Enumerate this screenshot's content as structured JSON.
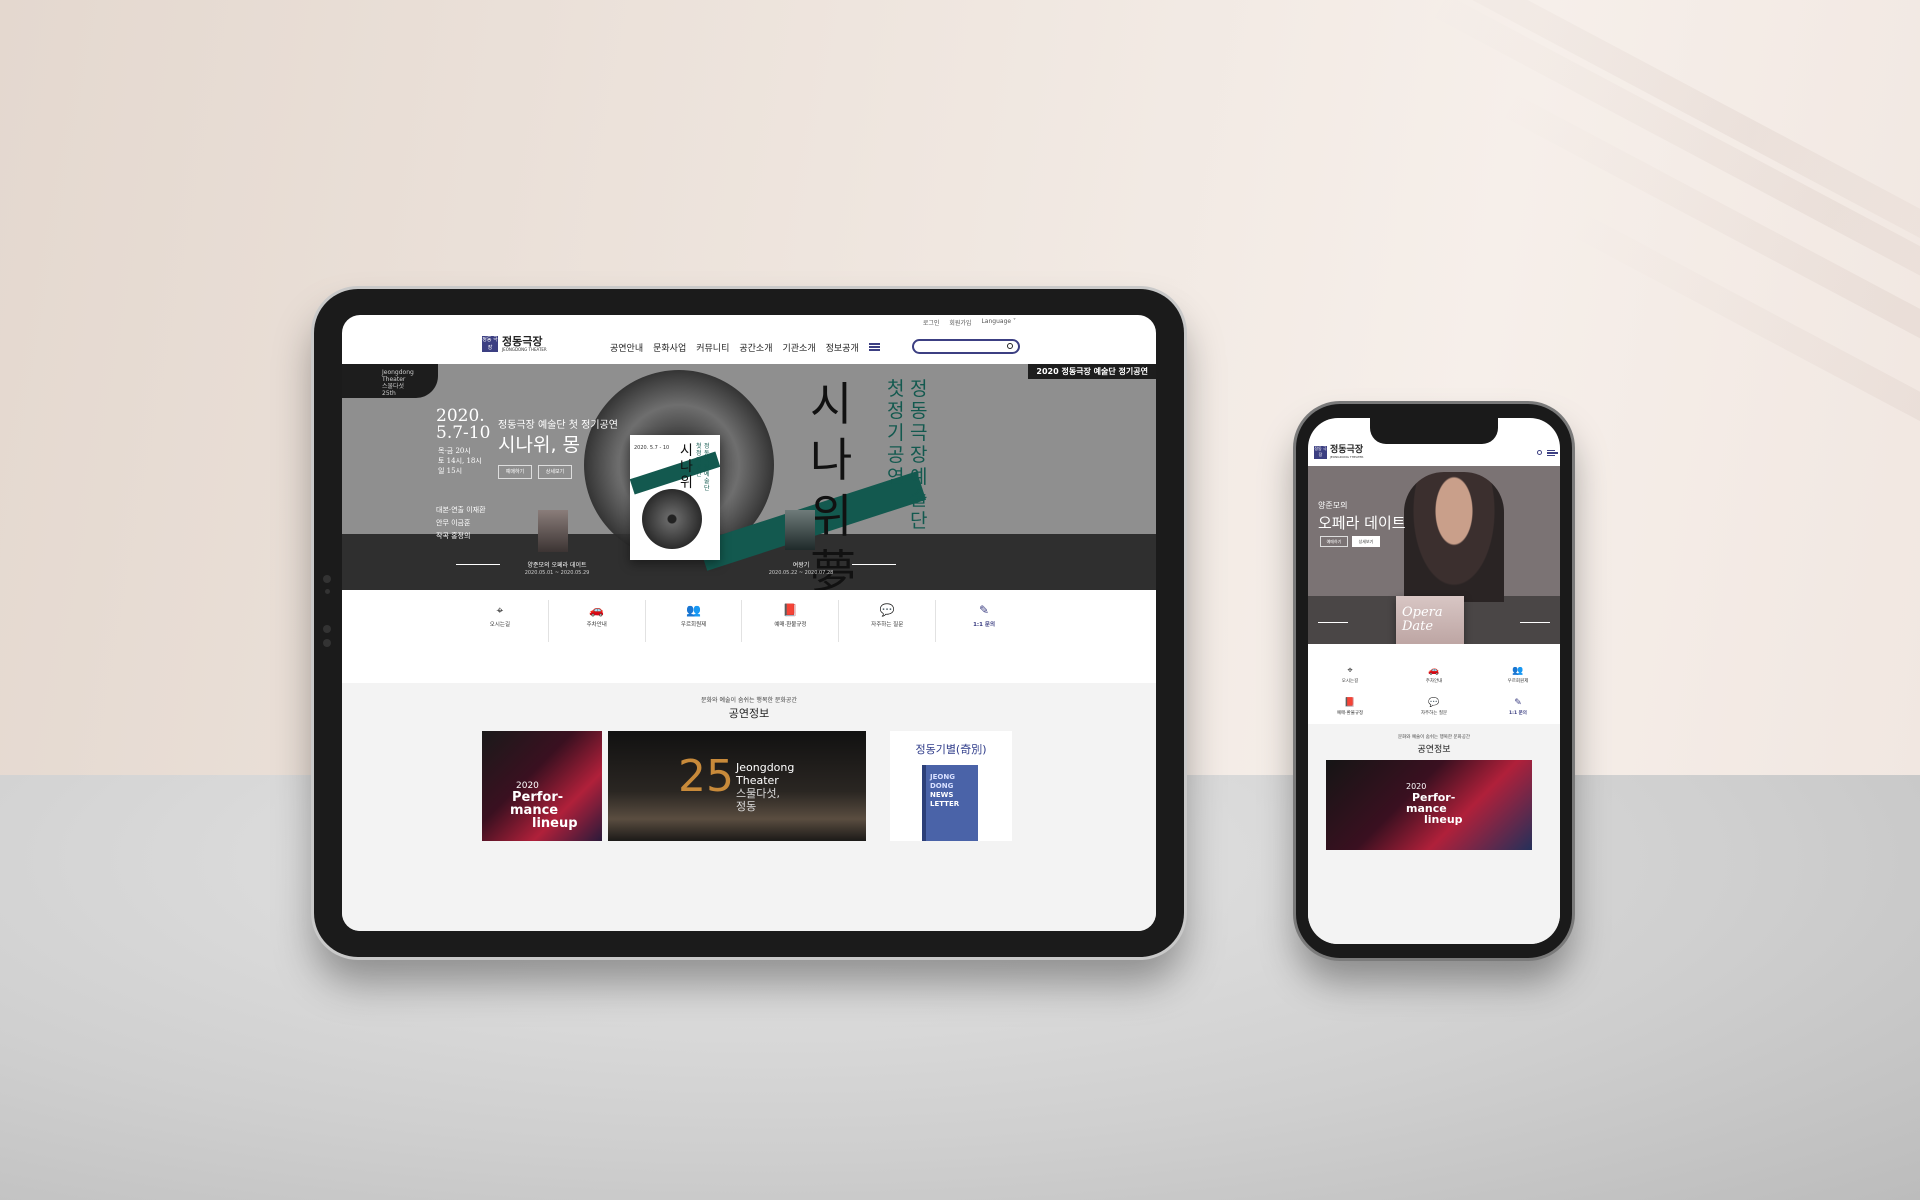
{
  "tablet": {
    "topbar": {
      "login": "로그인",
      "join": "회원가입",
      "language": "Language ˅"
    },
    "logo": {
      "mark": "정동 극장",
      "title": "정동극장",
      "sub": "JEONGDONG THEATER"
    },
    "nav": [
      "공연안내",
      "문화사업",
      "커뮤니티",
      "공간소개",
      "기관소개",
      "정보공개"
    ],
    "hero": {
      "badge": [
        "Jeongdong",
        "Theater",
        "스물다섯",
        "25th"
      ],
      "ribbon": "2020 정동극장 예술단 정기공연",
      "date": [
        "2020.",
        "5.7-10"
      ],
      "subtitle": "정동극장 예술단 첫 정기공연",
      "title": "시나위, 몽",
      "times": [
        "목-금 20시",
        "토 14시, 18시",
        "일 15시"
      ],
      "btn_book": "예매하기",
      "btn_detail": "상세보기",
      "credits": [
        "대본·연출 이재환",
        "안무 이금훈",
        "작곡 홍정의"
      ],
      "big_vertical": "시나위夢",
      "teal_vertical_1": "정동극장 예술단",
      "teal_vertical_2": "첫 정기공연",
      "left_caption": "양준모의 오페라 데이트",
      "left_date": "2020.05.01 ~ 2020.05.29",
      "right_caption": "여왕기",
      "right_date": "2020.05.22 ~ 2020.07.28",
      "poster": {
        "date": "2020. 5.7 - 10",
        "vert1": "시나위",
        "vert2": "정동극장 예술단",
        "vert3": "첫 정기공연"
      }
    },
    "icons": [
      {
        "glyph": "⌖",
        "label": "오시는길"
      },
      {
        "glyph": "🚗",
        "label": "주차안내"
      },
      {
        "glyph": "👥",
        "label": "우르회원제"
      },
      {
        "glyph": "📕",
        "label": "예매·환불규정"
      },
      {
        "glyph": "💬",
        "label": "자주하는 질문"
      },
      {
        "glyph": "✎",
        "label": "1:1 문의"
      }
    ],
    "info": {
      "subtitle": "문화와 예술이 숨쉬는 행복한 문화공간",
      "title": "공연정보",
      "card1": {
        "year": "2020",
        "line1": "Perfor-",
        "line2": "mance",
        "line3": "lineup"
      },
      "card2": {
        "num": "25",
        "line1": "Jeongdong",
        "line2": "Theater",
        "line3": "스물다섯,",
        "line4": "정동"
      },
      "card3": {
        "title": "정동기별(奇別)",
        "book": [
          "JEONG",
          "DONG",
          "NEWS",
          "LETTER"
        ]
      }
    }
  },
  "phone": {
    "logo": {
      "mark": "정동 극장",
      "title": "정동극장",
      "sub": "JEONGDONG THEATER"
    },
    "hero": {
      "subtitle": "양준모의",
      "title": "오페라 데이트",
      "btn_book": "예매하기",
      "btn_detail": "상세보기",
      "poster": [
        "Opera",
        "Date"
      ]
    },
    "icons": [
      {
        "glyph": "⌖",
        "label": "오시는길"
      },
      {
        "glyph": "🚗",
        "label": "주차안내"
      },
      {
        "glyph": "👥",
        "label": "우르회원제"
      },
      {
        "glyph": "📕",
        "label": "예매·환불규정"
      },
      {
        "glyph": "💬",
        "label": "자주하는 질문"
      },
      {
        "glyph": "✎",
        "label": "1:1 문의"
      }
    ],
    "info": {
      "subtitle": "문화와 예술이 숨쉬는 행복한 문화공간",
      "title": "공연정보",
      "card": {
        "year": "2020",
        "line1": "Perfor-",
        "line2": "mance",
        "line3": "lineup"
      }
    }
  },
  "colors": {
    "brand": "#3c3f82",
    "teal": "#13594f",
    "hero": "#8f8f8f"
  }
}
